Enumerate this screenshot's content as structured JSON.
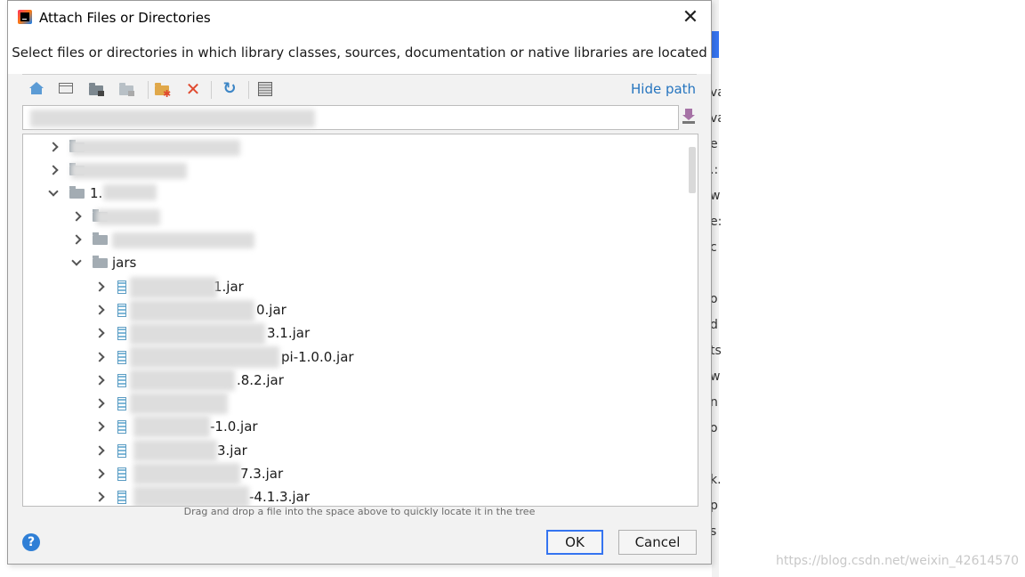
{
  "dialog": {
    "title": "Attach Files or Directories",
    "description": "Select files or directories in which library classes, sources, documentation or native libraries are located",
    "hide_path_label": "Hide path",
    "drag_tip": "Drag and drop a file into the space above to quickly locate it in the tree",
    "ok_label": "OK",
    "cancel_label": "Cancel",
    "help_label": "?"
  },
  "toolbar": {
    "icons": [
      "home-icon",
      "desktop-icon",
      "project-icon",
      "module-icon",
      "new-folder-icon",
      "delete-icon",
      "refresh-icon",
      "show-hidden-icon"
    ]
  },
  "tree": {
    "rows": [
      {
        "label": "",
        "expanded": false,
        "type": "folder"
      },
      {
        "label": "",
        "expanded": false,
        "type": "folder"
      },
      {
        "label": "1.",
        "expanded": true,
        "type": "folder"
      },
      {
        "label": "",
        "expanded": false,
        "type": "folder"
      },
      {
        "label": "",
        "expanded": false,
        "type": "folder"
      },
      {
        "label": "jars",
        "expanded": true,
        "type": "folder"
      },
      {
        "label": "1.jar",
        "type": "jar"
      },
      {
        "label": "0.jar",
        "type": "jar"
      },
      {
        "label": "3.1.jar",
        "type": "jar"
      },
      {
        "label": "pi-1.0.0.jar",
        "type": "jar"
      },
      {
        "label": ".8.2.jar",
        "type": "jar"
      },
      {
        "label": "",
        "type": "jar"
      },
      {
        "label": "-1.0.jar",
        "type": "jar"
      },
      {
        "label": "3.jar",
        "type": "jar"
      },
      {
        "label": "7.3.jar",
        "type": "jar"
      },
      {
        "label": "-4.1.3.jar",
        "type": "jar"
      }
    ]
  },
  "background": {
    "letters": [
      "va",
      "va",
      "e",
      ".:",
      "w",
      "e:",
      "c",
      "",
      "o",
      "d",
      "ts",
      "w",
      "n",
      "o",
      "",
      "k.",
      "p",
      "s"
    ],
    "watermark": "https://blog.csdn.net/weixin_42614570"
  }
}
